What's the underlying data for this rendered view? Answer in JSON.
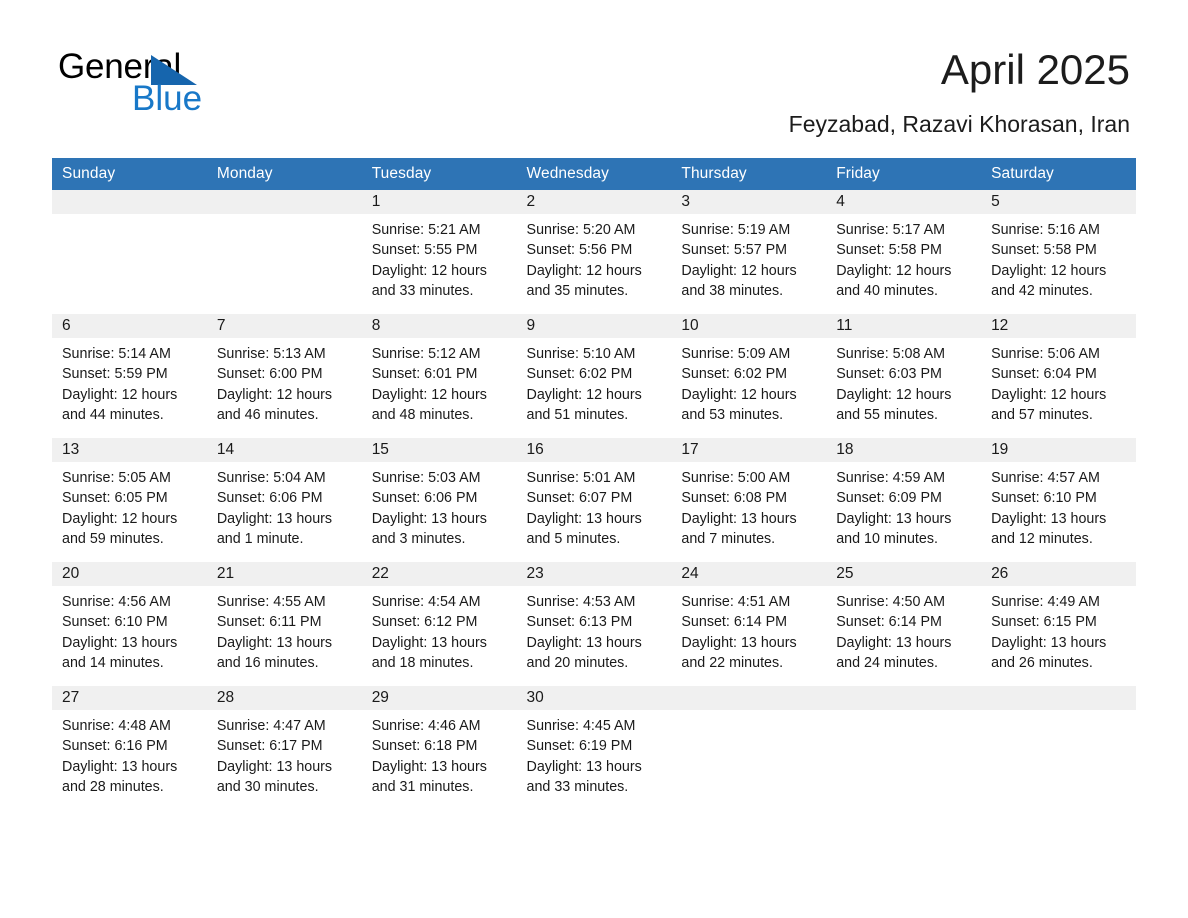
{
  "brand": {
    "name_top": "General",
    "name_bottom": "Blue",
    "triangle_color": "#1665ad",
    "blue_color": "#1878c8"
  },
  "header": {
    "title": "April 2025",
    "subtitle": "Feyzabad, Razavi Khorasan, Iran"
  },
  "theme": {
    "header_blue": "#2e74b5",
    "daynum_band": "#f0f0f0",
    "text": "#1a1a1a"
  },
  "labels": {
    "sunrise_prefix": "Sunrise:",
    "sunset_prefix": "Sunset:",
    "daylight_prefix": "Daylight:"
  },
  "columns": [
    "Sunday",
    "Monday",
    "Tuesday",
    "Wednesday",
    "Thursday",
    "Friday",
    "Saturday"
  ],
  "weeks": [
    [
      {
        "day": "",
        "sunrise": "",
        "sunset": "",
        "daylight_line1": "",
        "daylight_line2": ""
      },
      {
        "day": "",
        "sunrise": "",
        "sunset": "",
        "daylight_line1": "",
        "daylight_line2": ""
      },
      {
        "day": "1",
        "sunrise": "Sunrise: 5:21 AM",
        "sunset": "Sunset: 5:55 PM",
        "daylight_line1": "Daylight: 12 hours",
        "daylight_line2": "and 33 minutes."
      },
      {
        "day": "2",
        "sunrise": "Sunrise: 5:20 AM",
        "sunset": "Sunset: 5:56 PM",
        "daylight_line1": "Daylight: 12 hours",
        "daylight_line2": "and 35 minutes."
      },
      {
        "day": "3",
        "sunrise": "Sunrise: 5:19 AM",
        "sunset": "Sunset: 5:57 PM",
        "daylight_line1": "Daylight: 12 hours",
        "daylight_line2": "and 38 minutes."
      },
      {
        "day": "4",
        "sunrise": "Sunrise: 5:17 AM",
        "sunset": "Sunset: 5:58 PM",
        "daylight_line1": "Daylight: 12 hours",
        "daylight_line2": "and 40 minutes."
      },
      {
        "day": "5",
        "sunrise": "Sunrise: 5:16 AM",
        "sunset": "Sunset: 5:58 PM",
        "daylight_line1": "Daylight: 12 hours",
        "daylight_line2": "and 42 minutes."
      }
    ],
    [
      {
        "day": "6",
        "sunrise": "Sunrise: 5:14 AM",
        "sunset": "Sunset: 5:59 PM",
        "daylight_line1": "Daylight: 12 hours",
        "daylight_line2": "and 44 minutes."
      },
      {
        "day": "7",
        "sunrise": "Sunrise: 5:13 AM",
        "sunset": "Sunset: 6:00 PM",
        "daylight_line1": "Daylight: 12 hours",
        "daylight_line2": "and 46 minutes."
      },
      {
        "day": "8",
        "sunrise": "Sunrise: 5:12 AM",
        "sunset": "Sunset: 6:01 PM",
        "daylight_line1": "Daylight: 12 hours",
        "daylight_line2": "and 48 minutes."
      },
      {
        "day": "9",
        "sunrise": "Sunrise: 5:10 AM",
        "sunset": "Sunset: 6:02 PM",
        "daylight_line1": "Daylight: 12 hours",
        "daylight_line2": "and 51 minutes."
      },
      {
        "day": "10",
        "sunrise": "Sunrise: 5:09 AM",
        "sunset": "Sunset: 6:02 PM",
        "daylight_line1": "Daylight: 12 hours",
        "daylight_line2": "and 53 minutes."
      },
      {
        "day": "11",
        "sunrise": "Sunrise: 5:08 AM",
        "sunset": "Sunset: 6:03 PM",
        "daylight_line1": "Daylight: 12 hours",
        "daylight_line2": "and 55 minutes."
      },
      {
        "day": "12",
        "sunrise": "Sunrise: 5:06 AM",
        "sunset": "Sunset: 6:04 PM",
        "daylight_line1": "Daylight: 12 hours",
        "daylight_line2": "and 57 minutes."
      }
    ],
    [
      {
        "day": "13",
        "sunrise": "Sunrise: 5:05 AM",
        "sunset": "Sunset: 6:05 PM",
        "daylight_line1": "Daylight: 12 hours",
        "daylight_line2": "and 59 minutes."
      },
      {
        "day": "14",
        "sunrise": "Sunrise: 5:04 AM",
        "sunset": "Sunset: 6:06 PM",
        "daylight_line1": "Daylight: 13 hours",
        "daylight_line2": "and 1 minute."
      },
      {
        "day": "15",
        "sunrise": "Sunrise: 5:03 AM",
        "sunset": "Sunset: 6:06 PM",
        "daylight_line1": "Daylight: 13 hours",
        "daylight_line2": "and 3 minutes."
      },
      {
        "day": "16",
        "sunrise": "Sunrise: 5:01 AM",
        "sunset": "Sunset: 6:07 PM",
        "daylight_line1": "Daylight: 13 hours",
        "daylight_line2": "and 5 minutes."
      },
      {
        "day": "17",
        "sunrise": "Sunrise: 5:00 AM",
        "sunset": "Sunset: 6:08 PM",
        "daylight_line1": "Daylight: 13 hours",
        "daylight_line2": "and 7 minutes."
      },
      {
        "day": "18",
        "sunrise": "Sunrise: 4:59 AM",
        "sunset": "Sunset: 6:09 PM",
        "daylight_line1": "Daylight: 13 hours",
        "daylight_line2": "and 10 minutes."
      },
      {
        "day": "19",
        "sunrise": "Sunrise: 4:57 AM",
        "sunset": "Sunset: 6:10 PM",
        "daylight_line1": "Daylight: 13 hours",
        "daylight_line2": "and 12 minutes."
      }
    ],
    [
      {
        "day": "20",
        "sunrise": "Sunrise: 4:56 AM",
        "sunset": "Sunset: 6:10 PM",
        "daylight_line1": "Daylight: 13 hours",
        "daylight_line2": "and 14 minutes."
      },
      {
        "day": "21",
        "sunrise": "Sunrise: 4:55 AM",
        "sunset": "Sunset: 6:11 PM",
        "daylight_line1": "Daylight: 13 hours",
        "daylight_line2": "and 16 minutes."
      },
      {
        "day": "22",
        "sunrise": "Sunrise: 4:54 AM",
        "sunset": "Sunset: 6:12 PM",
        "daylight_line1": "Daylight: 13 hours",
        "daylight_line2": "and 18 minutes."
      },
      {
        "day": "23",
        "sunrise": "Sunrise: 4:53 AM",
        "sunset": "Sunset: 6:13 PM",
        "daylight_line1": "Daylight: 13 hours",
        "daylight_line2": "and 20 minutes."
      },
      {
        "day": "24",
        "sunrise": "Sunrise: 4:51 AM",
        "sunset": "Sunset: 6:14 PM",
        "daylight_line1": "Daylight: 13 hours",
        "daylight_line2": "and 22 minutes."
      },
      {
        "day": "25",
        "sunrise": "Sunrise: 4:50 AM",
        "sunset": "Sunset: 6:14 PM",
        "daylight_line1": "Daylight: 13 hours",
        "daylight_line2": "and 24 minutes."
      },
      {
        "day": "26",
        "sunrise": "Sunrise: 4:49 AM",
        "sunset": "Sunset: 6:15 PM",
        "daylight_line1": "Daylight: 13 hours",
        "daylight_line2": "and 26 minutes."
      }
    ],
    [
      {
        "day": "27",
        "sunrise": "Sunrise: 4:48 AM",
        "sunset": "Sunset: 6:16 PM",
        "daylight_line1": "Daylight: 13 hours",
        "daylight_line2": "and 28 minutes."
      },
      {
        "day": "28",
        "sunrise": "Sunrise: 4:47 AM",
        "sunset": "Sunset: 6:17 PM",
        "daylight_line1": "Daylight: 13 hours",
        "daylight_line2": "and 30 minutes."
      },
      {
        "day": "29",
        "sunrise": "Sunrise: 4:46 AM",
        "sunset": "Sunset: 6:18 PM",
        "daylight_line1": "Daylight: 13 hours",
        "daylight_line2": "and 31 minutes."
      },
      {
        "day": "30",
        "sunrise": "Sunrise: 4:45 AM",
        "sunset": "Sunset: 6:19 PM",
        "daylight_line1": "Daylight: 13 hours",
        "daylight_line2": "and 33 minutes."
      },
      {
        "day": "",
        "sunrise": "",
        "sunset": "",
        "daylight_line1": "",
        "daylight_line2": ""
      },
      {
        "day": "",
        "sunrise": "",
        "sunset": "",
        "daylight_line1": "",
        "daylight_line2": ""
      },
      {
        "day": "",
        "sunrise": "",
        "sunset": "",
        "daylight_line1": "",
        "daylight_line2": ""
      }
    ]
  ]
}
